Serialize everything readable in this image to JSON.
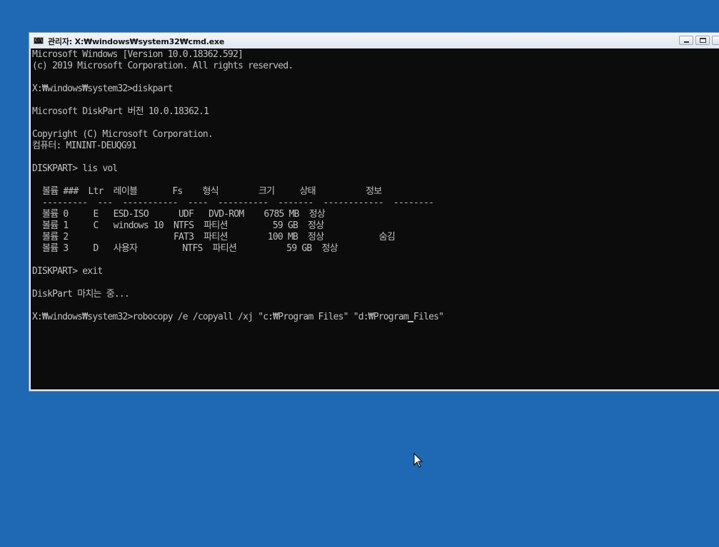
{
  "window": {
    "title": "관리자: X:₩windows₩system32₩cmd.exe",
    "icon_label": "C:\\"
  },
  "console": {
    "lines": [
      "Microsoft Windows [Version 10.0.18362.592]",
      "(c) 2019 Microsoft Corporation. All rights reserved.",
      "",
      "X:₩windows₩system32>diskpart",
      "",
      "Microsoft DiskPart 버전 10.0.18362.1",
      "",
      "Copyright (C) Microsoft Corporation.",
      "컴퓨터: MININT-DEUQG91",
      "",
      "DISKPART> lis vol",
      "",
      "  볼륨 ###  Ltr  레이블       Fs    형식        크기     상태          정보",
      "  ---------  ---  -----------  ----  ----------  -------  ------------  --------",
      "  볼륨 0     E   ESD-ISO      UDF   DVD-ROM    6785 MB  정상",
      "  볼륨 1     C   windows 10  NTFS  파티션         59 GB  정상",
      "  볼륨 2                     FAT3  파티션        100 MB  정상           숨김",
      "  볼륨 3     D   사용자         NTFS  파티션          59 GB  정상",
      "",
      "DISKPART> exit",
      "",
      "DiskPart 마치는 중...",
      "",
      "X:₩windows₩system32>robocopy /e /copyall /xj \"c:₩Program Files\" \"d:₩Program Files\""
    ]
  }
}
